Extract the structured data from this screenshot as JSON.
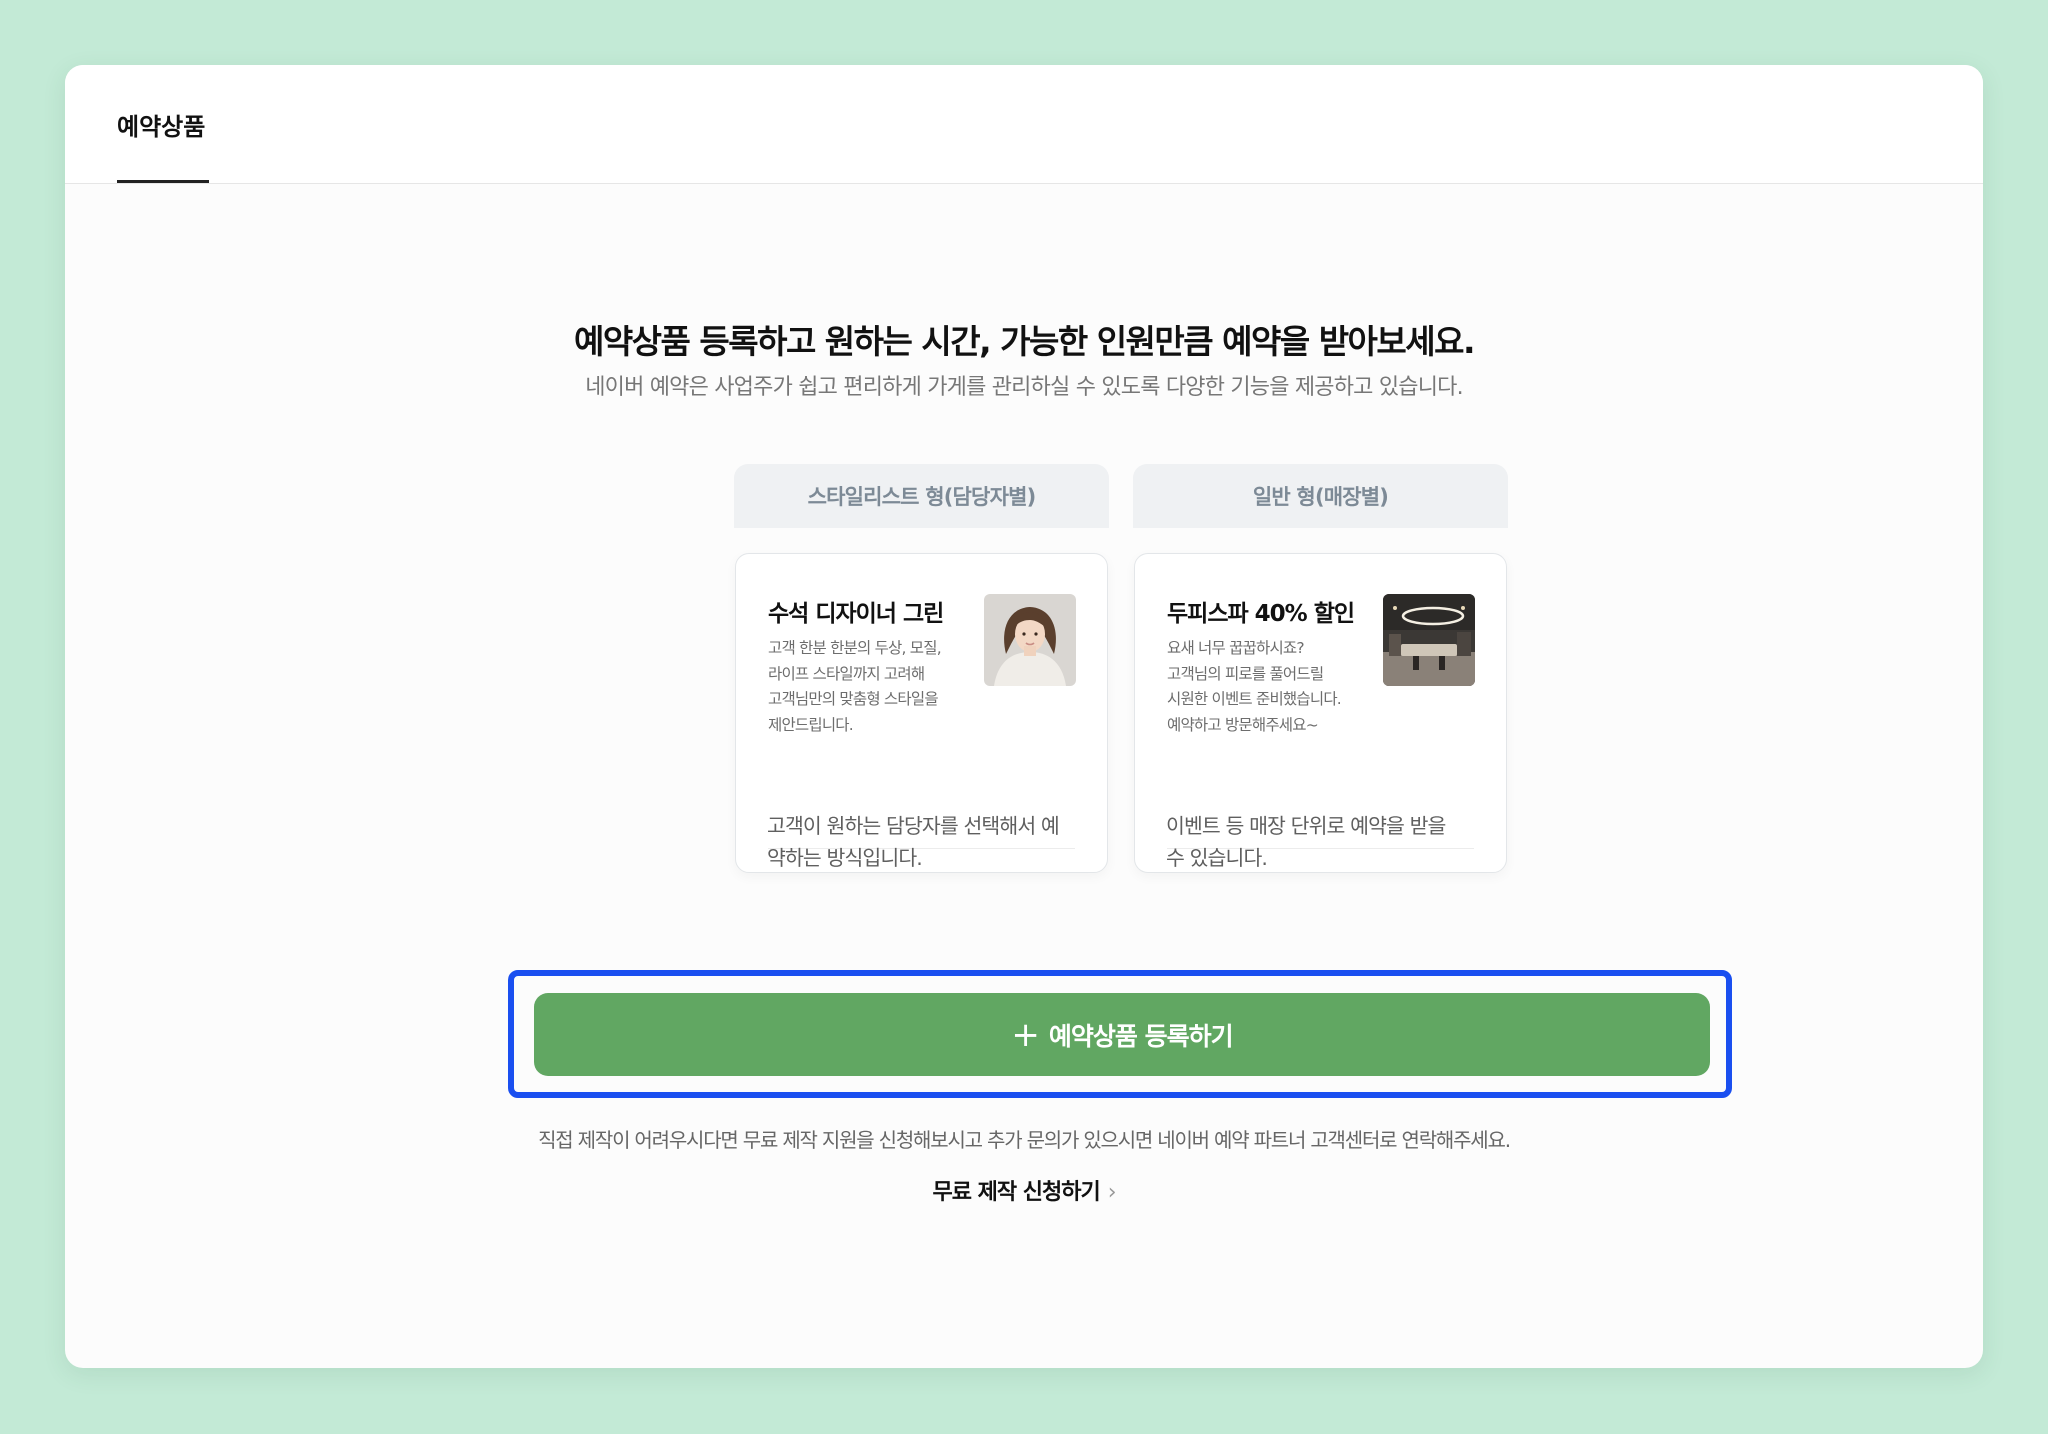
{
  "tabs": [
    {
      "label": "예약상품",
      "active": true
    }
  ],
  "headline": "예약상품 등록하고 원하는 시간, 가능한 인원만큼 예약을 받아보세요.",
  "subline": "네이버 예약은 사업주가 쉽고 편리하게 가게를 관리하실 수 있도록 다양한 기능을 제공하고 있습니다.",
  "types": [
    {
      "tab_label": "스타일리스트 형(담당자별)",
      "card_title": "수석 디자이너 그린",
      "card_desc": [
        "고객 한분 한분의 두상, 모질,",
        "라이프 스타일까지 고려해",
        "고객님만의 맞춤형 스타일을",
        "제안드립니다."
      ],
      "footer": [
        "고객이 원하는 담당자를 선택해서 예",
        "약하는 방식입니다."
      ],
      "thumbnail": "stylist-portrait"
    },
    {
      "tab_label": "일반 형(매장별)",
      "card_title": "두피스파 40% 할인",
      "card_desc": [
        "요새 너무 꿉꿉하시죠?",
        "고객님의 피로를 풀어드릴",
        "시원한 이벤트 준비했습니다.",
        "예약하고 방문해주세요~"
      ],
      "footer": [
        "이벤트 등 매장 단위로 예약을 받을",
        "수 있습니다."
      ],
      "thumbnail": "salon-interior"
    }
  ],
  "register_button": {
    "icon": "plus-icon",
    "label": "예약상품 등록하기"
  },
  "notice": "직접 제작이 어려우시다면 무료 제작 지원을 신청해보시고 추가 문의가 있으시면 네이버 예약 파트너 고객센터로 연락해주세요.",
  "free_link": {
    "label": "무료 제작 신청하기",
    "icon": "chevron-right-icon"
  },
  "colors": {
    "background": "#c3ead6",
    "button": "#61a762",
    "highlight": "#1a4ff0"
  }
}
